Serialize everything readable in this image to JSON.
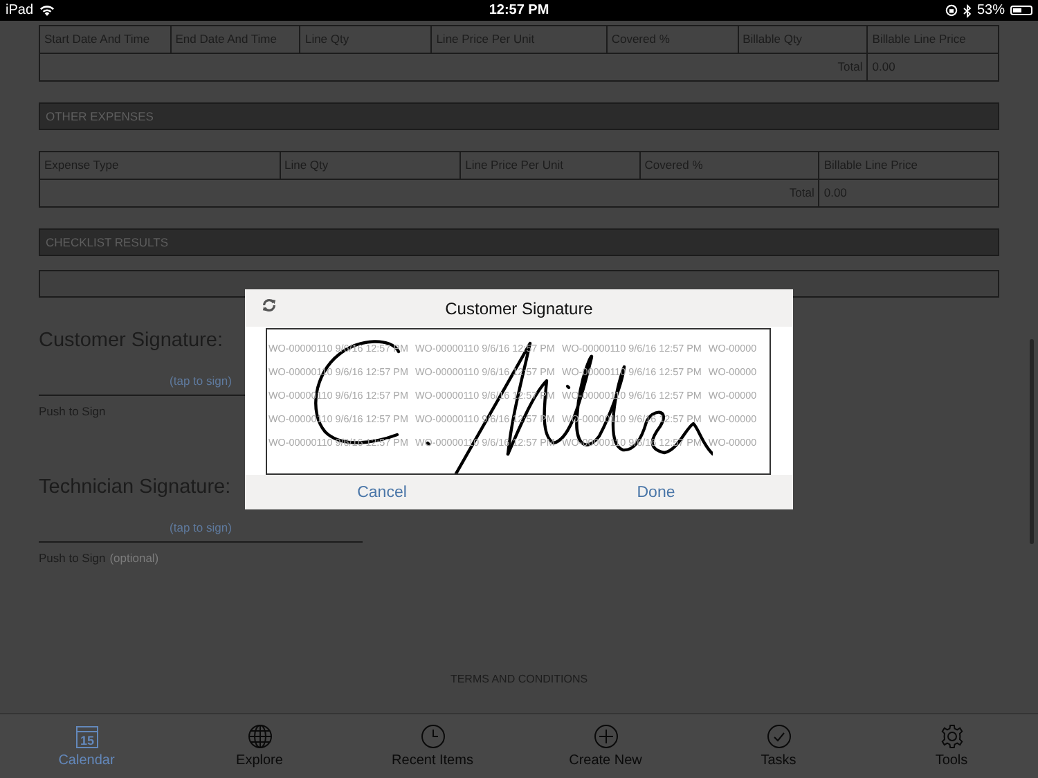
{
  "status_bar": {
    "device": "iPad",
    "time": "12:57 PM",
    "battery": "53%"
  },
  "labor_table": {
    "columns": [
      "Start Date And Time",
      "End Date And Time",
      "Line Qty",
      "Line Price Per Unit",
      "Covered %",
      "Billable Qty",
      "Billable Line Price"
    ],
    "total_label": "Total",
    "total_value": "0.00"
  },
  "other_expenses": {
    "title": "OTHER EXPENSES",
    "columns": [
      "Expense Type",
      "Line Qty",
      "Line Price Per Unit",
      "Covered %",
      "Billable Line Price"
    ],
    "total_label": "Total",
    "total_value": "0.00"
  },
  "checklist_results": {
    "title": "CHECKLIST RESULTS"
  },
  "signatures": [
    {
      "label": "Customer Signature:",
      "hint": "(tap to sign)",
      "push": "Push to Sign"
    },
    {
      "label": "Technician Signature:",
      "hint": "(tap to sign)",
      "push": "Push to Sign",
      "note": "(optional)"
    }
  ],
  "terms_title": "TERMS AND CONDITIONS",
  "dialog": {
    "title": "Customer Signature",
    "watermark_rows": [
      [
        "WO-00000110 9/6/16 12:57 PM",
        "WO-00000110 9/6/16 12:57 PM",
        "WO-00000110 9/6/16 12:57 PM",
        "WO-00000"
      ],
      [
        "WO-00000110 9/6/16 12:57 PM",
        "WO-00000110 9/6/16 12:57 PM",
        "WO-00000110 9/6/16 12:57 PM",
        "WO-00000"
      ],
      [
        "WO-00000110 9/6/16 12:57 PM",
        "WO-00000110 9/6/16 12:57 PM",
        "WO-00000110 9/6/16 12:57 PM",
        "WO-00000"
      ],
      [
        "WO-00000110 9/6/16 12:57 PM",
        "WO-00000110 9/6/16 12:57 PM",
        "WO-00000110 9/6/16 12:57 PM",
        "WO-00000"
      ],
      [
        "WO-00000110 9/6/16 12:57 PM",
        "WO-00000110 9/6/16 12:57 PM",
        "WO-00000110 9/6/16 12:57 PM",
        "WO-00000"
      ]
    ],
    "buttons": [
      "Cancel",
      "Done"
    ]
  },
  "tab_bar": [
    {
      "kind": "calendar",
      "label": "Calendar",
      "day": "15",
      "selected": true
    },
    {
      "kind": "globe",
      "label": "Explore",
      "selected": false
    },
    {
      "kind": "clock",
      "label": "Recent Items",
      "selected": false
    },
    {
      "kind": "plus",
      "label": "Create New",
      "selected": false
    },
    {
      "kind": "check",
      "label": "Tasks",
      "selected": false
    },
    {
      "kind": "gear",
      "label": "Tools",
      "selected": false
    }
  ]
}
